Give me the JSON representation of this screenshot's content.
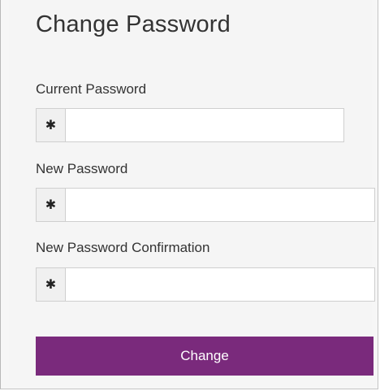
{
  "form": {
    "title": "Change Password",
    "current_label": "Current Password",
    "current_value": "",
    "new_label": "New Password",
    "new_value": "",
    "confirm_label": "New Password Confirmation",
    "confirm_value": "",
    "addon_glyph": "✱",
    "submit_label": "Change"
  },
  "colors": {
    "accent": "#7a2a7c"
  },
  "icons": [
    "asterisk-icon"
  ]
}
